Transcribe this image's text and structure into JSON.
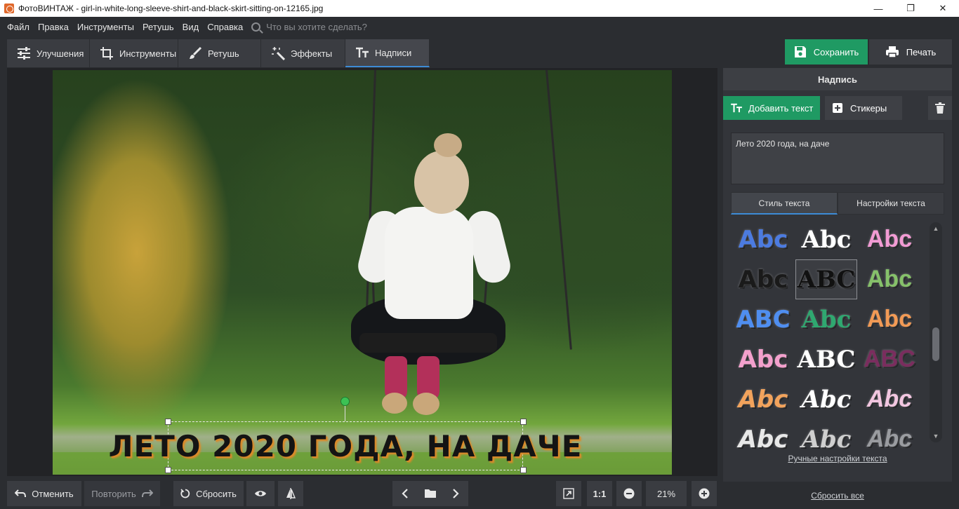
{
  "window": {
    "title": "ФотоВИНТАЖ - girl-in-white-long-sleeve-shirt-and-black-skirt-sitting-on-12165.jpg",
    "minimize": "—",
    "restore": "❐",
    "close": "✕"
  },
  "menu": {
    "items": [
      "Файл",
      "Правка",
      "Инструменты",
      "Ретушь",
      "Вид",
      "Справка"
    ],
    "search_placeholder": "Что вы хотите сделать?"
  },
  "tabs": [
    {
      "label": "Улучшения",
      "icon": "sliders-icon"
    },
    {
      "label": "Инструменты",
      "icon": "crop-icon"
    },
    {
      "label": "Ретушь",
      "icon": "brush-icon"
    },
    {
      "label": "Эффекты",
      "icon": "magic-wand-icon"
    },
    {
      "label": "Надписи",
      "icon": "text-icon",
      "active": true
    }
  ],
  "actions": {
    "save": "Сохранить",
    "print": "Печать"
  },
  "canvas": {
    "overlay_text": "ЛЕТО 2020 ГОДА, НА ДАЧЕ"
  },
  "panel": {
    "title": "Надпись",
    "add_text": "Добавить текст",
    "stickers": "Стикеры",
    "text_value": "Лето 2020 года, на даче",
    "tab_style": "Стиль текста",
    "tab_settings": "Настройки текста",
    "manual_settings": "Ручные настройки текста",
    "styles": [
      {
        "text": "Abc",
        "color": "#4c7be0"
      },
      {
        "text": "Abc",
        "color": "#ffffff"
      },
      {
        "text": "Abc",
        "color": "#f29bd4"
      },
      {
        "text": "Abc",
        "color": "#1a1a1a"
      },
      {
        "text": "ABC",
        "color": "#111111"
      },
      {
        "text": "Abc",
        "color": "#86c16a"
      },
      {
        "text": "ABC",
        "color": "#4f8ef0"
      },
      {
        "text": "Abc",
        "color": "#2fa870"
      },
      {
        "text": "Abc",
        "color": "#f29a55"
      },
      {
        "text": "Abc",
        "color": "#f3a0cc"
      },
      {
        "text": "ABC",
        "color": "#ffffff"
      },
      {
        "text": "ABC",
        "color": "#7a2d5e"
      },
      {
        "text": "Abc",
        "color": "#f2a35c"
      },
      {
        "text": "Abc",
        "color": "#ffffff"
      },
      {
        "text": "Abc",
        "color": "#f2c6e0"
      },
      {
        "text": "Abc",
        "color": "#e8e8e8"
      },
      {
        "text": "Abc",
        "color": "#cfcfcf"
      },
      {
        "text": "Abc",
        "color": "#9a9ca0"
      }
    ]
  },
  "bottom": {
    "undo": "Отменить",
    "redo": "Повторить",
    "reset": "Сбросить",
    "actual_size": "1:1",
    "zoom": "21%",
    "reset_all": "Сбросить все"
  },
  "colors": {
    "accent": "#1f9a63",
    "tab_highlight": "#3d8bd6"
  }
}
